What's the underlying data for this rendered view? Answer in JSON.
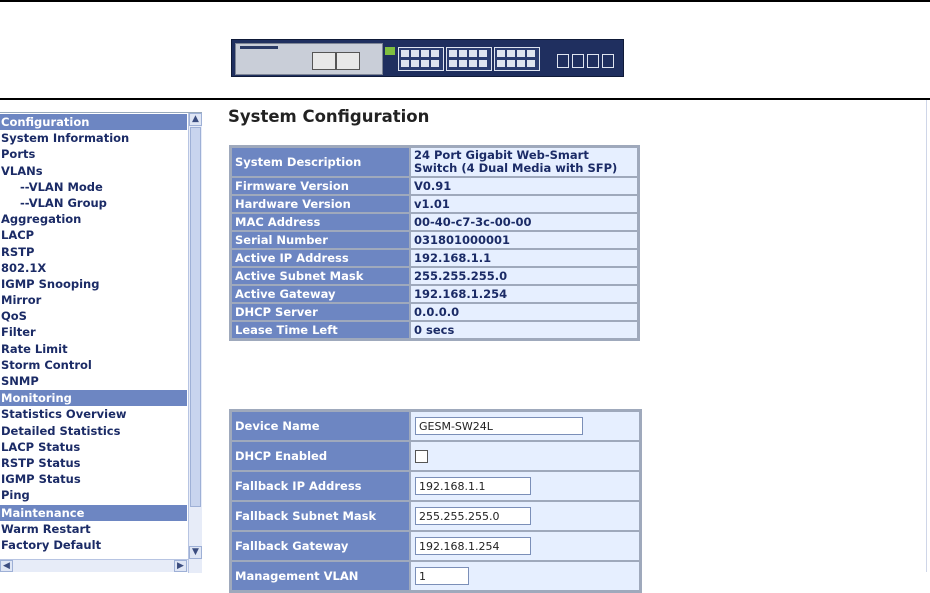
{
  "sidebar": {
    "items": [
      {
        "label": "Configuration",
        "type": "head"
      },
      {
        "label": "System Information",
        "type": "item"
      },
      {
        "label": "Ports",
        "type": "item"
      },
      {
        "label": "VLANs",
        "type": "item"
      },
      {
        "label": "--VLAN Mode",
        "type": "sub"
      },
      {
        "label": "--VLAN Group",
        "type": "sub"
      },
      {
        "label": "Aggregation",
        "type": "item"
      },
      {
        "label": "LACP",
        "type": "item"
      },
      {
        "label": "RSTP",
        "type": "item"
      },
      {
        "label": "802.1X",
        "type": "item"
      },
      {
        "label": "IGMP Snooping",
        "type": "item"
      },
      {
        "label": "Mirror",
        "type": "item"
      },
      {
        "label": "QoS",
        "type": "item"
      },
      {
        "label": "Filter",
        "type": "item"
      },
      {
        "label": "Rate Limit",
        "type": "item"
      },
      {
        "label": "Storm Control",
        "type": "item"
      },
      {
        "label": "SNMP",
        "type": "item"
      },
      {
        "label": "Monitoring",
        "type": "head"
      },
      {
        "label": "Statistics Overview",
        "type": "item"
      },
      {
        "label": "Detailed Statistics",
        "type": "item"
      },
      {
        "label": "LACP Status",
        "type": "item"
      },
      {
        "label": "RSTP Status",
        "type": "item"
      },
      {
        "label": "IGMP Status",
        "type": "item"
      },
      {
        "label": "Ping",
        "type": "item"
      },
      {
        "label": "Maintenance",
        "type": "head"
      },
      {
        "label": "Warm Restart",
        "type": "item"
      },
      {
        "label": "Factory Default",
        "type": "item"
      }
    ]
  },
  "main": {
    "title": "System Configuration",
    "info": [
      {
        "label": "System Description",
        "value": "24 Port Gigabit Web-Smart Switch (4 Dual Media with SFP)"
      },
      {
        "label": "Firmware Version",
        "value": "V0.91"
      },
      {
        "label": "Hardware Version",
        "value": "v1.01"
      },
      {
        "label": "MAC Address",
        "value": "00-40-c7-3c-00-00"
      },
      {
        "label": "Serial Number",
        "value": "031801000001"
      },
      {
        "label": "Active IP Address",
        "value": "192.168.1.1"
      },
      {
        "label": "Active Subnet Mask",
        "value": "255.255.255.0"
      },
      {
        "label": "Active Gateway",
        "value": "192.168.1.254"
      },
      {
        "label": "DHCP Server",
        "value": "0.0.0.0"
      },
      {
        "label": "Lease Time Left",
        "value": "0 secs"
      }
    ],
    "settings": {
      "device_name_label": "Device Name",
      "device_name_value": "GESM-SW24L",
      "dhcp_enabled_label": "DHCP Enabled",
      "dhcp_enabled_checked": false,
      "fallback_ip_label": "Fallback IP Address",
      "fallback_ip_value": "192.168.1.1",
      "fallback_mask_label": "Fallback Subnet Mask",
      "fallback_mask_value": "255.255.255.0",
      "fallback_gateway_label": "Fallback Gateway",
      "fallback_gateway_value": "192.168.1.254",
      "mgmt_vlan_label": "Management VLAN",
      "mgmt_vlan_value": "1"
    }
  },
  "icons": {
    "scroll_up": "chevron-up-icon",
    "scroll_down": "chevron-down-icon",
    "scroll_left": "chevron-left-icon",
    "scroll_right": "chevron-right-icon"
  },
  "colors": {
    "header_blue": "#6d86c2",
    "value_bg": "#e6efff",
    "nav_text": "#1b2b66"
  }
}
